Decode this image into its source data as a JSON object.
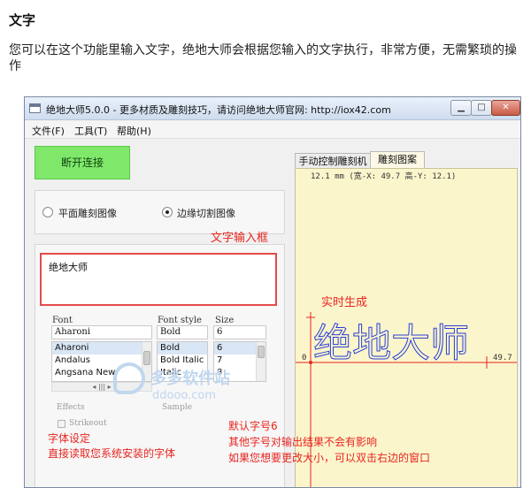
{
  "article": {
    "heading": "文字",
    "paragraph": "您可以在这个功能里输入文字，绝地大师会根据您输入的文字执行，非常方便，无需繁琐的操作"
  },
  "window": {
    "title": "绝地大师5.0.0 - 更多材质及雕刻技巧，请访问绝地大师官网: http://iox42.com",
    "min_glyph": "▁",
    "max_glyph": "□",
    "close_glyph": "✕"
  },
  "menu": [
    {
      "label": "文件(F)"
    },
    {
      "label": "工具(T)"
    },
    {
      "label": "帮助(H)"
    }
  ],
  "connect_button": "断开连接",
  "mode": {
    "option1": "平面雕刻图像",
    "option2": "边缘切割图像",
    "selected": "边缘切割图像"
  },
  "text_input": {
    "value": "绝地大师"
  },
  "font_picker": {
    "font_label": "Font",
    "style_label": "Font style",
    "size_label": "Size",
    "font_value": "Aharoni",
    "style_value": "Bold",
    "size_value": "6",
    "fonts": [
      "Aharoni",
      "Andalus",
      "Angsana New"
    ],
    "styles": [
      "Bold",
      "Bold Italic",
      "Italic"
    ],
    "sizes": [
      "6",
      "7",
      "8"
    ],
    "effects_label": "Effects",
    "strikeout_label": "Strikeout",
    "sample_label": "Sample",
    "hscroll_glyph": "◂ ||| ▸"
  },
  "tabs": [
    {
      "label": "手动控制雕刻机"
    },
    {
      "label": "雕刻图案"
    }
  ],
  "preview": {
    "coords": "12.1 mm  (宽-X: 49.7  高-Y: 12.1)",
    "engraved_text": "绝地大师",
    "axis_zero": "0",
    "axis_max": "49.7",
    "color_stroke": "#2a3fd8",
    "color_axis": "#e8251f"
  },
  "annotations": {
    "text_input_box": "文字输入框",
    "realtime": "实时生成",
    "font_setting_1": "字体设定",
    "font_setting_2": "直接读取您系统安装的字体",
    "default_size_1": "默认字号6",
    "default_size_2": "其他字号对输出结果不会有影响",
    "default_size_3": "如果您想要更改大小，可以双击右边的窗口"
  },
  "watermark": {
    "text": "多多软件站",
    "url": "ddooo.com"
  }
}
